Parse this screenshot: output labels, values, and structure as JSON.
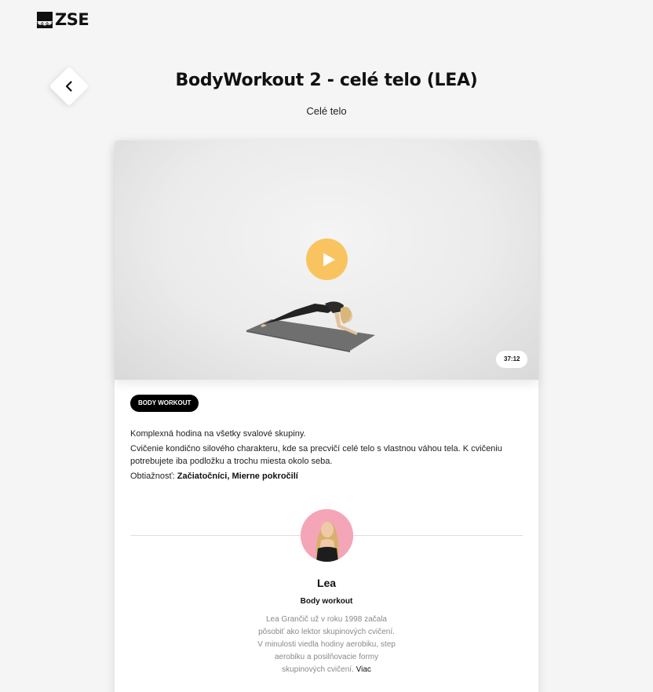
{
  "header": {
    "logo_text": "ZSE",
    "back_icon": "chevron-left-icon"
  },
  "page": {
    "title": "BodyWorkout 2 - celé telo (LEA)",
    "subtitle": "Celé telo"
  },
  "video": {
    "duration": "37:12",
    "play_icon": "play-icon",
    "play_color": "#f9c45f"
  },
  "workout": {
    "tag": "BODY WORKOUT",
    "description_1": "Komplexná hodina na všetky svalové skupiny.",
    "description_2": "Cvičenie kondično silového charakteru, kde sa precvičí celé telo s vlastnou váhou tela. K cvičeniu potrebujete iba podložku a trochu miesta okolo seba.",
    "difficulty_label": "Obtiažnosť:",
    "difficulty_value": "Začiatočníci, Mierne pokročilí"
  },
  "trainer": {
    "name": "Lea",
    "role": "Body workout",
    "bio": "Lea Grančič už v roku 1998 začala pôsobiť ako lektor skupinových cvičení. V minulosti viedla hodiny aerobiku, step aerobiku a posilňovacie formy skupinových cvičení.",
    "more_label": "Viac"
  }
}
